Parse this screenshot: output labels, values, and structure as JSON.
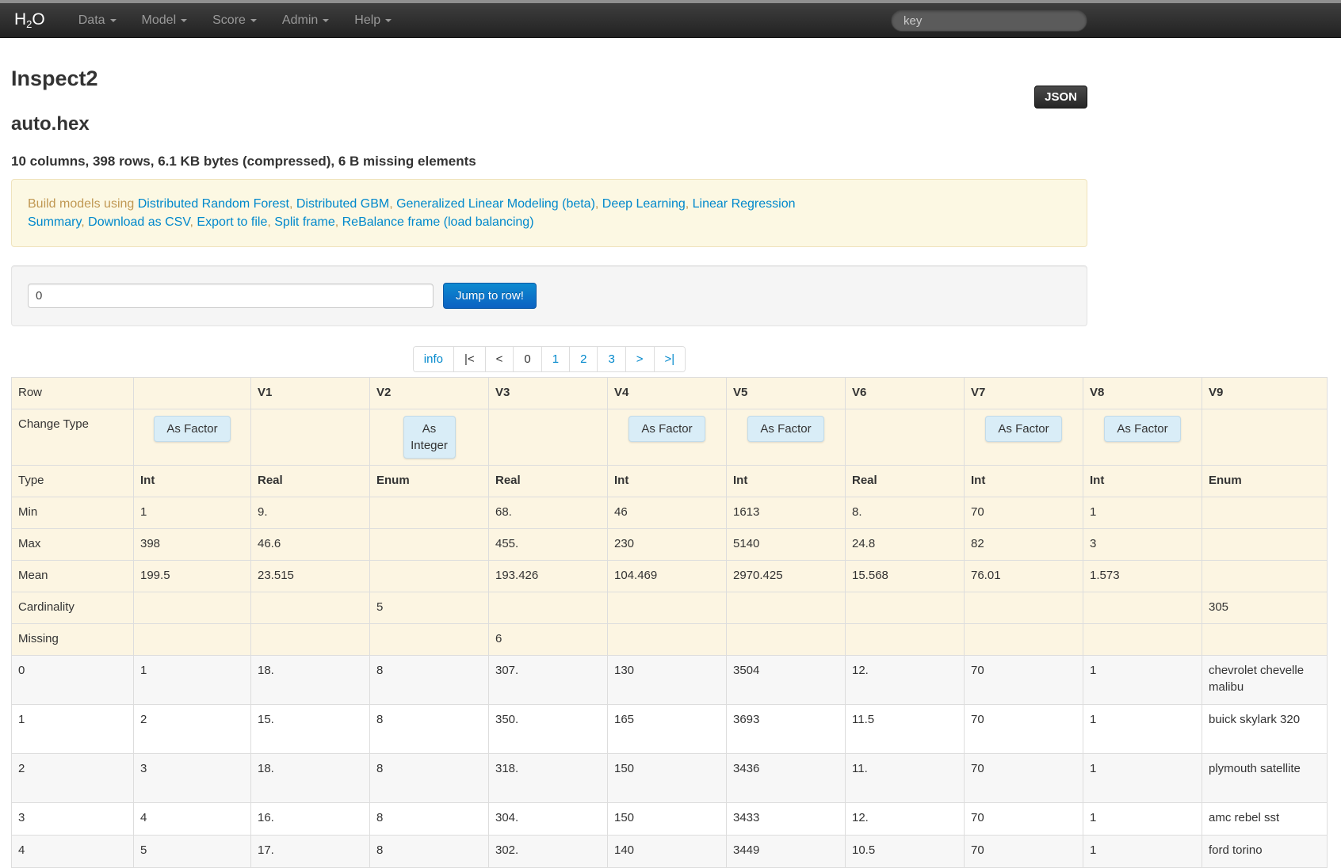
{
  "navbar": {
    "brand_parts": [
      "H",
      "2",
      "O"
    ],
    "items": [
      {
        "label": "Data"
      },
      {
        "label": "Model"
      },
      {
        "label": "Score"
      },
      {
        "label": "Admin"
      },
      {
        "label": "Help"
      }
    ],
    "search_placeholder": "key"
  },
  "page": {
    "title": "Inspect2",
    "json_label": "JSON",
    "frame_name": "auto.hex",
    "summary": "10 columns, 398 rows, 6.1 KB bytes (compressed), 6 B missing elements"
  },
  "build_bar": {
    "prefix": "Build models using ",
    "model_links": [
      "Distributed Random Forest",
      "Distributed GBM",
      "Generalized Linear Modeling (beta)",
      "Deep Learning",
      "Linear Regression"
    ],
    "action_links": [
      "Summary",
      "Download as CSV",
      "Export to file",
      "Split frame",
      "ReBalance frame (load balancing)"
    ]
  },
  "jump": {
    "input_value": "0",
    "button_label": "Jump to row!"
  },
  "pagination": [
    {
      "name": "info",
      "label": "info",
      "state": "link"
    },
    {
      "name": "first",
      "label": "|<",
      "state": "text"
    },
    {
      "name": "prev",
      "label": "<",
      "state": "text"
    },
    {
      "name": "page-0",
      "label": "0",
      "state": "text"
    },
    {
      "name": "page-1",
      "label": "1",
      "state": "link"
    },
    {
      "name": "page-2",
      "label": "2",
      "state": "link"
    },
    {
      "name": "page-3",
      "label": "3",
      "state": "link"
    },
    {
      "name": "next",
      "label": ">",
      "state": "link"
    },
    {
      "name": "last",
      "label": ">|",
      "state": "link"
    }
  ],
  "table": {
    "columns": [
      "Row",
      "",
      "V1",
      "V2",
      "V3",
      "V4",
      "V5",
      "V6",
      "V7",
      "V8",
      "V9"
    ],
    "change_type": {
      "label": "Change Type",
      "buttons": [
        "As Factor",
        "",
        "As Integer",
        "",
        "As Factor",
        "As Factor",
        "",
        "As Factor",
        "As Factor",
        ""
      ]
    },
    "stat_rows": [
      {
        "label": "Type",
        "bold": true,
        "values": [
          "Int",
          "Real",
          "Enum",
          "Real",
          "Int",
          "Int",
          "Real",
          "Int",
          "Int",
          "Enum"
        ]
      },
      {
        "label": "Min",
        "bold": false,
        "values": [
          "1",
          "9.",
          "",
          "68.",
          "46",
          "1613",
          "8.",
          "70",
          "1",
          ""
        ]
      },
      {
        "label": "Max",
        "bold": false,
        "values": [
          "398",
          "46.6",
          "",
          "455.",
          "230",
          "5140",
          "24.8",
          "82",
          "3",
          ""
        ]
      },
      {
        "label": "Mean",
        "bold": false,
        "values": [
          "199.5",
          "23.515",
          "",
          "193.426",
          "104.469",
          "2970.425",
          "15.568",
          "76.01",
          "1.573",
          ""
        ]
      },
      {
        "label": "Cardinality",
        "bold": false,
        "values": [
          "",
          "",
          "5",
          "",
          "",
          "",
          "",
          "",
          "",
          "305"
        ]
      },
      {
        "label": "Missing",
        "bold": false,
        "values": [
          "",
          "",
          "",
          "6",
          "",
          "",
          "",
          "",
          "",
          ""
        ]
      }
    ],
    "data_rows": [
      {
        "row": "0",
        "values": [
          "1",
          "18.",
          "8",
          "307.",
          "130",
          "3504",
          "12.",
          "70",
          "1",
          "chevrolet chevelle malibu"
        ]
      },
      {
        "row": "1",
        "values": [
          "2",
          "15.",
          "8",
          "350.",
          "165",
          "3693",
          "11.5",
          "70",
          "1",
          "buick skylark 320"
        ]
      },
      {
        "row": "2",
        "values": [
          "3",
          "18.",
          "8",
          "318.",
          "150",
          "3436",
          "11.",
          "70",
          "1",
          "plymouth satellite"
        ]
      },
      {
        "row": "3",
        "values": [
          "4",
          "16.",
          "8",
          "304.",
          "150",
          "3433",
          "12.",
          "70",
          "1",
          "amc rebel sst"
        ]
      },
      {
        "row": "4",
        "values": [
          "5",
          "17.",
          "8",
          "302.",
          "140",
          "3449",
          "10.5",
          "70",
          "1",
          "ford torino"
        ]
      }
    ]
  },
  "colors": {
    "link_blue": "#0088cc",
    "alert_text": "#c09853",
    "table_warn_bg": "#fcf5e2",
    "stripe_bg": "#f7f7f7",
    "cell_border": "#dddddd"
  }
}
